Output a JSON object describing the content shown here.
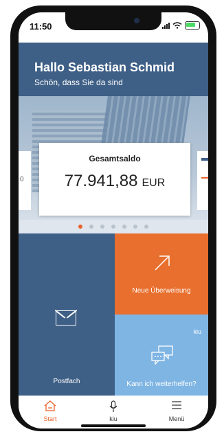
{
  "status_bar": {
    "time": "11:50"
  },
  "header": {
    "greeting": "Hallo Sebastian Schmid",
    "subtitle": "Schön, dass Sie da sind"
  },
  "balance_card": {
    "title": "Gesamtsaldo",
    "amount": "77.941,88",
    "currency": "EUR"
  },
  "carousel": {
    "total_pages": 7,
    "active_index": 0
  },
  "tiles": {
    "postfach": {
      "label": "Postfach",
      "icon": "envelope-icon"
    },
    "ueberweisung": {
      "label": "Neue Überweisung",
      "icon": "arrow-up-right-icon"
    },
    "kiu": {
      "tag": "kiu",
      "label": "Kann ich weiterhelfen?",
      "icon": "chat-bubbles-icon"
    }
  },
  "colors": {
    "primary_blue": "#3e5f86",
    "accent_orange": "#e86f2d",
    "light_blue": "#7fb5e3"
  },
  "tab_bar": {
    "items": [
      {
        "label": "Start",
        "icon": "home-icon",
        "active": true
      },
      {
        "label": "kiu",
        "icon": "microphone-icon",
        "active": false
      },
      {
        "label": "Menü",
        "icon": "menu-icon",
        "active": false
      }
    ]
  }
}
